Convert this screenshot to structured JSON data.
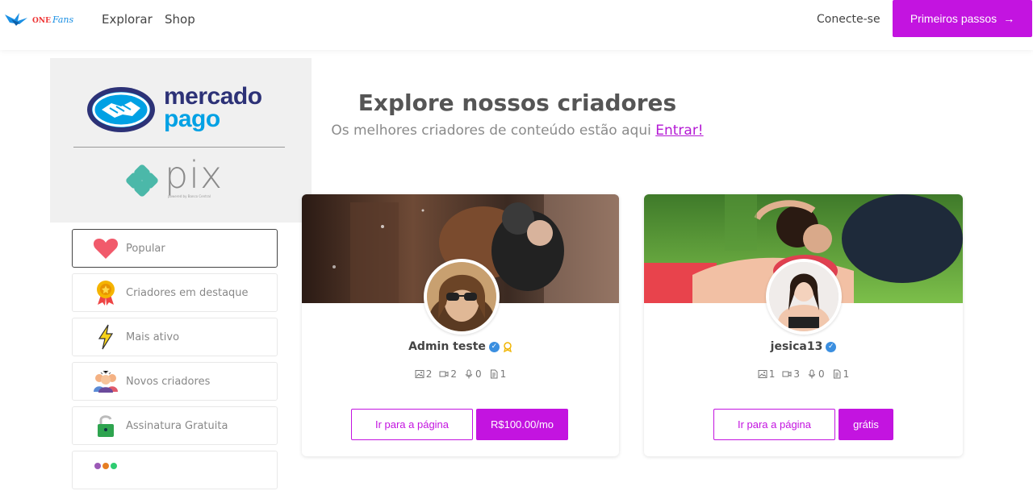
{
  "nav": {
    "logo_one": "ONE",
    "logo_fans": "Fans",
    "explore": "Explorar",
    "shop": "Shop",
    "login": "Conecte-se",
    "cta": "Primeiros passos",
    "cta_arrow": "→"
  },
  "payment": {
    "mp_line1": "mercado",
    "mp_line2": "pago",
    "pix": "pix",
    "pix_sub": "powered by Banco Central"
  },
  "hero": {
    "title": "Explore nossos criadores",
    "subtitle": "Os melhores criadores de conteúdo estão aqui",
    "link": "Entrar!"
  },
  "filters": [
    {
      "label": "Popular",
      "icon": "heart-icon"
    },
    {
      "label": "Criadores em destaque",
      "icon": "medal-icon"
    },
    {
      "label": "Mais ativo",
      "icon": "lightning-icon"
    },
    {
      "label": "Novos criadores",
      "icon": "group-icon"
    },
    {
      "label": "Assinatura Gratuita",
      "icon": "unlock-icon"
    }
  ],
  "creators": [
    {
      "name": "Admin teste",
      "photos": "2",
      "videos": "2",
      "audios": "0",
      "files": "1",
      "page_label": "Ir para a página",
      "price_label": "R$100.00/mo"
    },
    {
      "name": "jesica13",
      "photos": "1",
      "videos": "3",
      "audios": "0",
      "files": "1",
      "page_label": "Ir para a página",
      "price_label": "grátis"
    }
  ],
  "colors": {
    "accent": "#c314e0",
    "verified": "#3b8fe0",
    "mp_navy": "#2d3277",
    "mp_blue": "#00a1e4",
    "pix_teal": "#4bb8a9"
  }
}
